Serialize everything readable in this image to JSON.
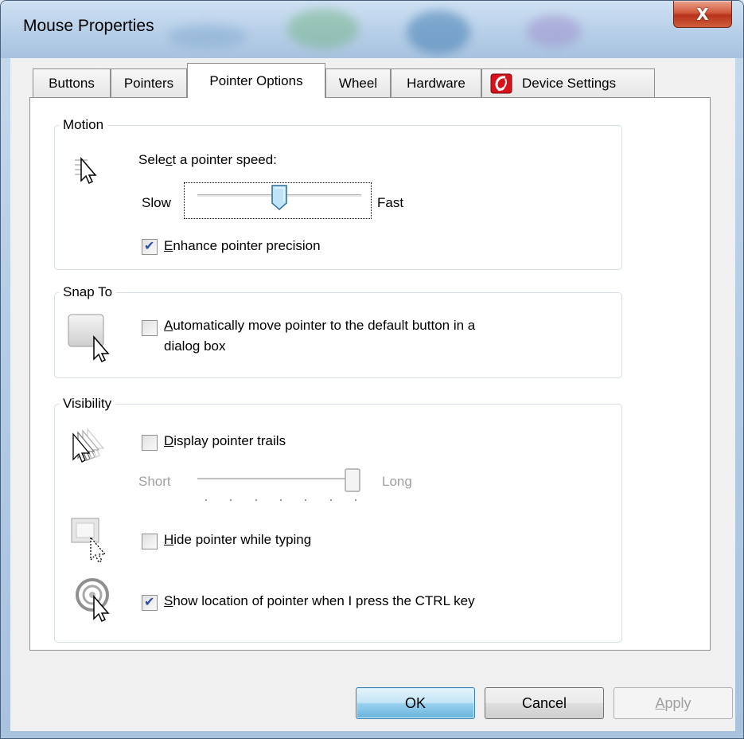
{
  "window": {
    "title": "Mouse Properties",
    "close_glyph": "X"
  },
  "tabs": [
    {
      "label": "Buttons"
    },
    {
      "label": "Pointers"
    },
    {
      "label": "Pointer Options"
    },
    {
      "label": "Wheel"
    },
    {
      "label": "Hardware"
    },
    {
      "label": "Device Settings",
      "icon": "synaptics-icon"
    }
  ],
  "motion": {
    "group_label": "Motion",
    "speed_label_pre": "Sele",
    "speed_label_key": "c",
    "speed_label_post": "t a pointer speed:",
    "slow": "Slow",
    "fast": "Fast",
    "speed_value": 0.5,
    "enhance_key": "E",
    "enhance_rest": "nhance pointer precision",
    "enhance_checked": true
  },
  "snap": {
    "group_label": "Snap To",
    "auto_key": "A",
    "auto_rest_line1": "utomatically move pointer to the default button in a",
    "auto_line2": "dialog box",
    "auto_checked": false
  },
  "visibility": {
    "group_label": "Visibility",
    "trails_key": "D",
    "trails_rest": "isplay pointer trails",
    "trails_checked": false,
    "short": "Short",
    "long": "Long",
    "trail_length_value": 1.0,
    "hide_key": "H",
    "hide_rest": "ide pointer while typing",
    "hide_checked": false,
    "show_key": "S",
    "show_rest": "how location of pointer when I press the CTRL key",
    "show_checked": true
  },
  "buttons": {
    "ok": "OK",
    "cancel": "Cancel",
    "apply_key": "A",
    "apply_rest": "pply"
  },
  "colors": {
    "accent": "#3c7fb1",
    "close": "#c8452a",
    "group_border": "#d5dfe5"
  }
}
